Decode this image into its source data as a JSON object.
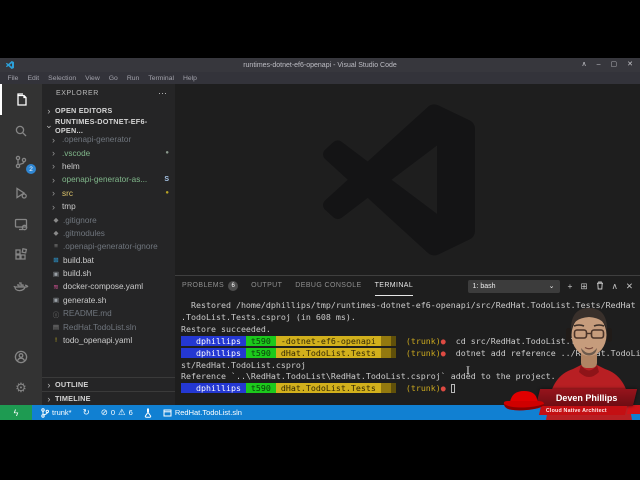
{
  "window": {
    "title": "runtimes-dotnet-ef6-openapi - Visual Studio Code",
    "controls": [
      "∧",
      "–",
      "▢",
      "✕"
    ],
    "menu": [
      "File",
      "Edit",
      "Selection",
      "View",
      "Go",
      "Run",
      "Terminal",
      "Help"
    ]
  },
  "activity_bar": {
    "scm_badge": "2"
  },
  "sidebar": {
    "title": "EXPLORER",
    "more": "⋯",
    "open_editors": "OPEN EDITORS",
    "project": "RUNTIMES-DOTNET-EF6-OPEN...",
    "outline": "OUTLINE",
    "timeline": "TIMELINE",
    "tree": [
      {
        "label": ".openapi-generator",
        "kind": "folder",
        "tone": "dim"
      },
      {
        "label": ".vscode",
        "kind": "folder",
        "tone": "green",
        "badge": "●",
        "badge_tone": "dim-dot"
      },
      {
        "label": "helm",
        "kind": "folder",
        "tone": ""
      },
      {
        "label": "openapi-generator-as...",
        "kind": "folder",
        "tone": "green",
        "badge": "S",
        "badge_tone": "blue"
      },
      {
        "label": "src",
        "kind": "folder",
        "tone": "yellow",
        "badge": "●",
        "badge_tone": "yellow-dot"
      },
      {
        "label": "tmp",
        "kind": "folder",
        "tone": ""
      },
      {
        "label": ".gitignore",
        "kind": "file",
        "tone": "dim",
        "icon": "◆",
        "icon_color": "#8a8a8a"
      },
      {
        "label": ".gitmodules",
        "kind": "file",
        "tone": "dim",
        "icon": "◆",
        "icon_color": "#8a8a8a"
      },
      {
        "label": ".openapi-generator-ignore",
        "kind": "file",
        "tone": "dim",
        "icon": "≡",
        "icon_color": "#8a8a8a"
      },
      {
        "label": "build.bat",
        "kind": "file",
        "tone": "",
        "icon": "⊞",
        "icon_color": "#2da8e8"
      },
      {
        "label": "build.sh",
        "kind": "file",
        "tone": "",
        "icon": "▣",
        "icon_color": "#9aa0a6"
      },
      {
        "label": "docker-compose.yaml",
        "kind": "file",
        "tone": "",
        "icon": "≋",
        "icon_color": "#e0559d"
      },
      {
        "label": "generate.sh",
        "kind": "file",
        "tone": "",
        "icon": "▣",
        "icon_color": "#9aa0a6"
      },
      {
        "label": "README.md",
        "kind": "file",
        "tone": "dim",
        "icon": "ⓘ",
        "icon_color": "#8a8a8a"
      },
      {
        "label": "RedHat.TodoList.sln",
        "kind": "file",
        "tone": "dim",
        "icon": "▤",
        "icon_color": "#8a8a8a"
      },
      {
        "label": "todo_openapi.yaml",
        "kind": "file",
        "tone": "",
        "icon": "!",
        "icon_color": "#d8c024"
      }
    ]
  },
  "panel": {
    "tabs": [
      {
        "label": "PROBLEMS",
        "badge": "6",
        "active": false
      },
      {
        "label": "OUTPUT",
        "active": false
      },
      {
        "label": "DEBUG CONSOLE",
        "active": false
      },
      {
        "label": "TERMINAL",
        "active": true
      }
    ],
    "shell": "1: bash",
    "terminal_lines": [
      {
        "spans": [
          {
            "cls": "fg",
            "text": "  Restored /home/dphillips/tmp/runtimes-dotnet-ef6-openapi/src/RedHat.TodoList.Tests/RedHat"
          }
        ]
      },
      {
        "spans": [
          {
            "cls": "fg",
            "text": ".TodoList.Tests.csproj (in 608 ms)."
          }
        ]
      },
      {
        "spans": [
          {
            "cls": "fg",
            "text": "Restore succeeded."
          }
        ]
      },
      {
        "spans": [
          {
            "cls": "fg",
            "text": ""
          }
        ]
      },
      {
        "spans": [
          {
            "cls": "pb",
            "text": "   dphillips "
          },
          {
            "cls": "pg",
            "text": " t590 "
          },
          {
            "cls": "py",
            "text": " -dotnet-ef6-openapi "
          },
          {
            "cls": "py2",
            "text": "  "
          },
          {
            "cls": "py3",
            "text": " "
          },
          {
            "cls": "fg",
            "text": "  "
          },
          {
            "cls": "tr",
            "text": "(trunk)"
          },
          {
            "cls": "rd",
            "text": "●"
          },
          {
            "cls": "fg",
            "text": "  cd src/RedHat.TodoList.Tests"
          }
        ]
      },
      {
        "spans": [
          {
            "cls": "pb",
            "text": "   dphillips "
          },
          {
            "cls": "pg",
            "text": " t590 "
          },
          {
            "cls": "py",
            "text": " dHat.TodoList.Tests "
          },
          {
            "cls": "py2",
            "text": "  "
          },
          {
            "cls": "py3",
            "text": " "
          },
          {
            "cls": "fg",
            "text": "  "
          },
          {
            "cls": "tr",
            "text": "(trunk)"
          },
          {
            "cls": "rd",
            "text": "●"
          },
          {
            "cls": "fg",
            "text": "  dotnet add reference ../RedHat.TodoList/RedHat.TodoLi"
          }
        ]
      },
      {
        "spans": [
          {
            "cls": "fg",
            "text": "st/RedHat.TodoList.csproj"
          }
        ]
      },
      {
        "spans": [
          {
            "cls": "fg",
            "text": "Reference `..\\RedHat.TodoList\\RedHat.TodoList.csproj` added to the project."
          }
        ]
      },
      {
        "spans": [
          {
            "cls": "pb",
            "text": "   dphillips "
          },
          {
            "cls": "pg",
            "text": " t590 "
          },
          {
            "cls": "py",
            "text": " dHat.TodoList.Tests "
          },
          {
            "cls": "py2",
            "text": "  "
          },
          {
            "cls": "py3",
            "text": " "
          },
          {
            "cls": "fg",
            "text": "  "
          },
          {
            "cls": "tr",
            "text": "(trunk)"
          },
          {
            "cls": "rd",
            "text": "●"
          },
          {
            "cls": "fg",
            "text": " "
          },
          {
            "cls": "cur",
            "text": ""
          }
        ]
      }
    ]
  },
  "status_bar": {
    "remote_glyph": "ϟ",
    "branch": "trunk*",
    "sync_glyph": "↻",
    "error_glyph": "⊘",
    "errors": "0",
    "warning_glyph": "⚠",
    "warnings": "6",
    "solution": "RedHat.TodoList.sln"
  },
  "overlay": {
    "name": "Deven Phillips",
    "role": "Cloud Native Architect"
  },
  "glyphs": {
    "chevron_right": "›",
    "chevron_down": "⌄",
    "plus": "+",
    "split": "⊞",
    "panel_up": "∧",
    "panel_close": "✕",
    "select_chevron": "⌄",
    "ibeam": "I"
  },
  "colors": {
    "status_blue": "#1180d2",
    "remote_green": "#1e9b52",
    "title_bar": "#37373d",
    "prompt_blue": "#2438d2",
    "prompt_green": "#1cc91c",
    "prompt_yellow": "#d2b01c",
    "redhat_red": "#c40f13"
  }
}
